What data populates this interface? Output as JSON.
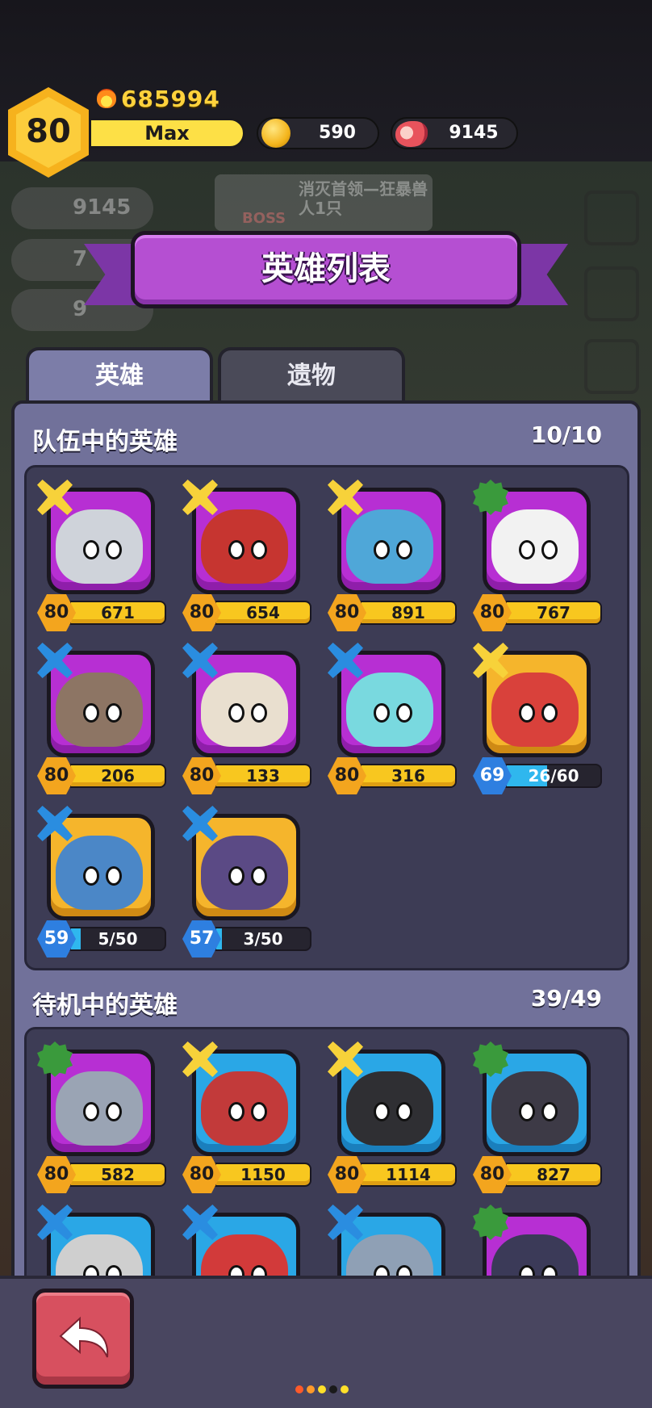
{
  "player": {
    "level": "80",
    "power": "685994",
    "exp_label": "Max"
  },
  "resources": {
    "gold": "590",
    "meat": "9145"
  },
  "background": {
    "res1": "9145",
    "res2": "7",
    "res3": "9",
    "quest": "消灭首领—狂暴兽人1只",
    "boss": "BOSS"
  },
  "title": "英雄列表",
  "tabs": [
    {
      "label": "英雄",
      "active": true
    },
    {
      "label": "遗物",
      "active": false
    }
  ],
  "team": {
    "title": "队伍中的英雄",
    "count": "10/10",
    "heroes": [
      {
        "name": "knight",
        "level": "80",
        "value": "671",
        "color": "purple",
        "badge": "gold",
        "progress": null
      },
      {
        "name": "archer",
        "level": "80",
        "value": "654",
        "color": "purple",
        "badge": "gold",
        "progress": null
      },
      {
        "name": "witch",
        "level": "80",
        "value": "891",
        "color": "purple",
        "badge": "gold",
        "progress": null
      },
      {
        "name": "sprout-bot",
        "level": "80",
        "value": "767",
        "color": "purple",
        "badge": "green",
        "progress": null
      },
      {
        "name": "treant",
        "level": "80",
        "value": "206",
        "color": "purple",
        "badge": "blue",
        "progress": null
      },
      {
        "name": "mummy",
        "level": "80",
        "value": "133",
        "color": "purple",
        "badge": "blue",
        "progress": null
      },
      {
        "name": "bunny",
        "level": "80",
        "value": "316",
        "color": "purple",
        "badge": "blue",
        "progress": null
      },
      {
        "name": "flame-warrior",
        "level": "69",
        "value": "26/60",
        "color": "gold",
        "badge": "gold",
        "progress": 0.43
      },
      {
        "name": "octo-diver",
        "level": "59",
        "value": "5/50",
        "color": "gold",
        "badge": "blue",
        "progress": 0.1
      },
      {
        "name": "hooded-bat",
        "level": "57",
        "value": "3/50",
        "color": "gold",
        "badge": "blue",
        "progress": 0.06
      }
    ]
  },
  "standby": {
    "title": "待机中的英雄",
    "count": "39/49",
    "heroes": [
      {
        "name": "mech-drone",
        "level": "80",
        "value": "582",
        "color": "purple",
        "badge": "green",
        "progress": null
      },
      {
        "name": "valkyrie",
        "level": "80",
        "value": "1150",
        "color": "blue",
        "badge": "gold",
        "progress": null
      },
      {
        "name": "ninja-frog",
        "level": "80",
        "value": "1114",
        "color": "blue",
        "badge": "gold",
        "progress": null
      },
      {
        "name": "block-robot",
        "level": "80",
        "value": "827",
        "color": "blue",
        "badge": "green",
        "progress": null
      },
      {
        "name": "spike-shell",
        "level": "",
        "value": "",
        "color": "blue",
        "badge": "blue",
        "progress": null
      },
      {
        "name": "red-helmet",
        "level": "",
        "value": "",
        "color": "blue",
        "badge": "blue",
        "progress": null
      },
      {
        "name": "rock-bird",
        "level": "",
        "value": "",
        "color": "blue",
        "badge": "blue",
        "progress": null
      },
      {
        "name": "dark-cat",
        "level": "",
        "value": "",
        "color": "purple",
        "badge": "green",
        "progress": null
      }
    ]
  },
  "page_dots": [
    "#ff5a2a",
    "#ff9a2a",
    "#ffe02a",
    "#1a1a1a",
    "#ffe02a"
  ],
  "colors": {
    "panel": "#71719a",
    "banner": "#b54fd2",
    "gold": "#f8c71f",
    "back_button": "#d7505f"
  }
}
